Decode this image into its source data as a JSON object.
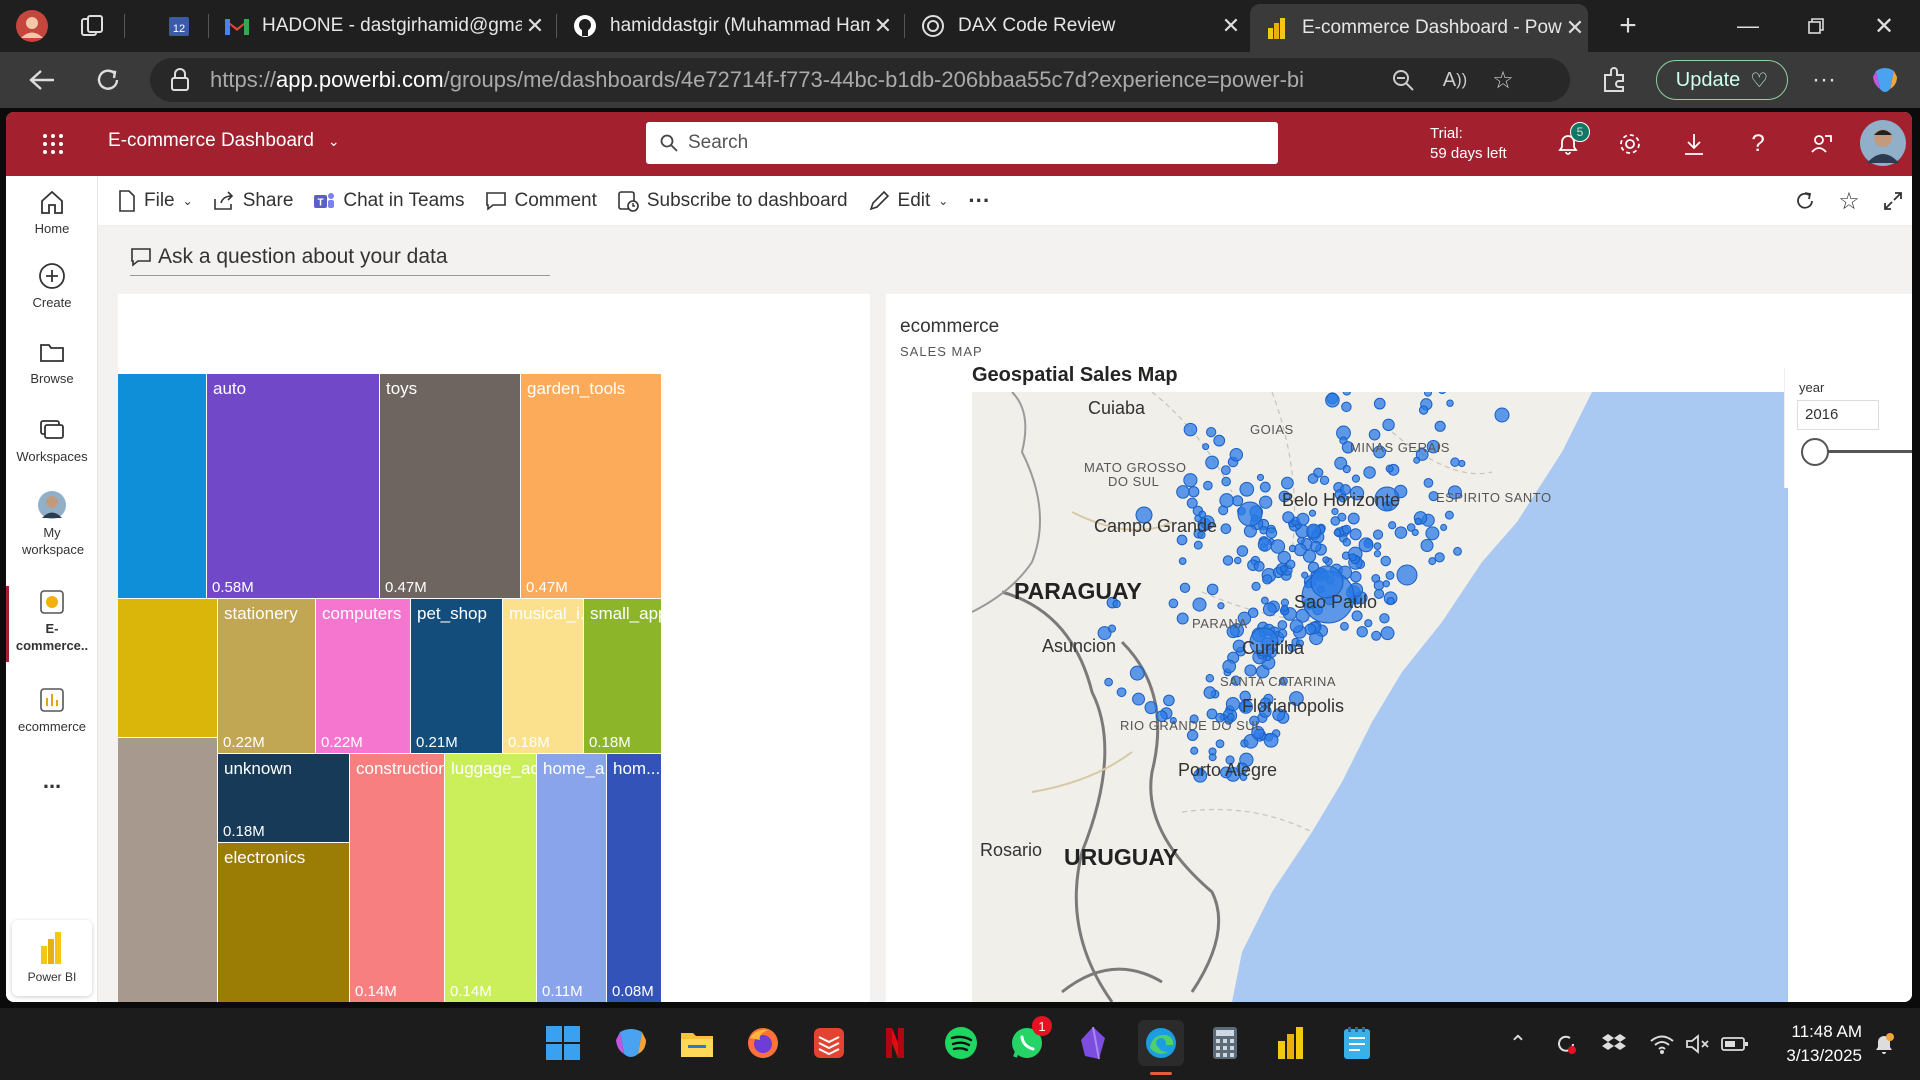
{
  "browser": {
    "tabs": [
      {
        "label": "",
        "icon": "tab-actions-icon"
      },
      {
        "label": "",
        "icon": "calendar-icon"
      },
      {
        "label": "HADONE - dastgirhamid@gmail",
        "icon": "gmail-icon"
      },
      {
        "label": "hamiddastgir (Muhammad Ham",
        "icon": "github-icon"
      },
      {
        "label": "DAX Code Review",
        "icon": "chatgpt-icon"
      },
      {
        "label": "E-commerce Dashboard - Power",
        "icon": "powerbi-icon",
        "active": true
      }
    ],
    "url_prefix": "https://",
    "url_host": "app.powerbi.com",
    "url_path": "/groups/me/dashboards/4e72714f-f773-44bc-b1db-206bbaa55c7d?experience=power-bi",
    "update_label": "Update"
  },
  "header": {
    "title": "E-commerce Dashboard",
    "search_placeholder": "Search",
    "trial_line1": "Trial:",
    "trial_line2": "59 days left",
    "notifications_count": "5"
  },
  "nav": {
    "items": [
      {
        "label": "Home"
      },
      {
        "label": "Create"
      },
      {
        "label": "Browse"
      },
      {
        "label": "Workspaces"
      },
      {
        "label": "My workspace"
      },
      {
        "label": "E-commerce.."
      },
      {
        "label": "ecommerce"
      }
    ],
    "more": "...",
    "powerbi_label": "Power BI"
  },
  "toolbar": {
    "file": "File",
    "share": "Share",
    "chat": "Chat in Teams",
    "comment": "Comment",
    "subscribe": "Subscribe to dashboard",
    "edit": "Edit",
    "more": "···"
  },
  "qa": {
    "placeholder": "Ask a question about your data"
  },
  "treemap": {
    "tiles": [
      {
        "name": "",
        "value": "",
        "color": "#0f8fd8"
      },
      {
        "name": "auto",
        "value": "0.58M",
        "color": "#7048c8"
      },
      {
        "name": "toys",
        "value": "0.47M",
        "color": "#6e6560"
      },
      {
        "name": "garden_tools",
        "value": "0.47M",
        "color": "#fcab5a"
      },
      {
        "name": "",
        "value": "",
        "color": "#dbb60a"
      },
      {
        "name": "stationery",
        "value": "0.22M",
        "color": "#c1a653"
      },
      {
        "name": "computers",
        "value": "0.22M",
        "color": "#f476cf"
      },
      {
        "name": "pet_shop",
        "value": "0.21M",
        "color": "#134d7c"
      },
      {
        "name": "musical_i...",
        "value": "0.18M",
        "color": "#fbe18e"
      },
      {
        "name": "small_app...",
        "value": "0.18M",
        "color": "#8cb52a"
      },
      {
        "name": "",
        "value": "",
        "color": "#a7998d"
      },
      {
        "name": "unknown",
        "value": "0.18M",
        "color": "#163a57"
      },
      {
        "name": "construction...",
        "value": "0.14M",
        "color": "#f87f7f"
      },
      {
        "name": "luggage_ac...",
        "value": "0.14M",
        "color": "#cbef5b"
      },
      {
        "name": "home_a...",
        "value": "0.11M",
        "color": "#8aa4ec"
      },
      {
        "name": "hom...",
        "value": "0.08M",
        "color": "#3453b8"
      },
      {
        "name": "electronics",
        "value": "",
        "color": "#9b7d06"
      }
    ]
  },
  "map": {
    "dataset": "ecommerce",
    "subtitle": "SALES MAP",
    "title": "Geospatial Sales Map",
    "cities": [
      "Cuiaba",
      "Campo Grande",
      "Belo Horizonte",
      "Asuncion",
      "Curitiba",
      "Florianopolis",
      "Porto Alegre",
      "Rosario",
      "Sao Paulo"
    ],
    "states": [
      "GOIAS",
      "MINAS GERAIS",
      "MATO GROSSO",
      "DO SUL",
      "ESPIRITO SANTO",
      "PARANA",
      "RIO GRANDE DO SUL",
      "SANTA CATARINA"
    ],
    "countries": [
      "PARAGUAY",
      "URUGUAY"
    ],
    "bubble_color": "#2b7be6"
  },
  "slicer": {
    "label": "year",
    "value": "2016"
  },
  "system": {
    "time": "11:48 AM",
    "date": "3/13/2025",
    "whatsapp_badge": "1"
  }
}
